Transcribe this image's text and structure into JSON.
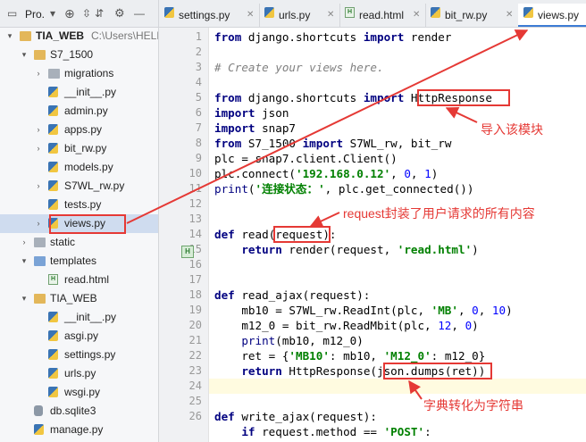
{
  "project_panel": {
    "title": "Pro.",
    "tree": [
      {
        "label": "TIA_WEB",
        "path": "C:\\Users\\HELE",
        "type": "folder-root",
        "expanded": true
      },
      {
        "label": "S7_1500",
        "type": "folder",
        "expanded": true
      },
      {
        "label": "migrations",
        "type": "folder",
        "expanded": false
      },
      {
        "label": "__init__.py",
        "type": "py"
      },
      {
        "label": "admin.py",
        "type": "py"
      },
      {
        "label": "apps.py",
        "type": "py",
        "expanded": false
      },
      {
        "label": "bit_rw.py",
        "type": "py",
        "expanded": false
      },
      {
        "label": "models.py",
        "type": "py"
      },
      {
        "label": "S7WL_rw.py",
        "type": "py",
        "expanded": false
      },
      {
        "label": "tests.py",
        "type": "py"
      },
      {
        "label": "views.py",
        "type": "py",
        "expanded": false,
        "selected": true
      },
      {
        "label": "static",
        "type": "folder",
        "expanded": false
      },
      {
        "label": "templates",
        "type": "folder",
        "expanded": true
      },
      {
        "label": "read.html",
        "type": "html"
      },
      {
        "label": "TIA_WEB",
        "type": "folder",
        "expanded": true
      },
      {
        "label": "__init__.py",
        "type": "py"
      },
      {
        "label": "asgi.py",
        "type": "py"
      },
      {
        "label": "settings.py",
        "type": "py"
      },
      {
        "label": "urls.py",
        "type": "py"
      },
      {
        "label": "wsgi.py",
        "type": "py"
      },
      {
        "label": "db.sqlite3",
        "type": "db"
      },
      {
        "label": "manage.py",
        "type": "py"
      }
    ]
  },
  "tabs": [
    {
      "label": "settings.py",
      "icon": "python-file-icon"
    },
    {
      "label": "urls.py",
      "icon": "python-file-icon"
    },
    {
      "label": "read.html",
      "icon": "html-file-icon"
    },
    {
      "label": "bit_rw.py",
      "icon": "python-file-icon"
    },
    {
      "label": "views.py",
      "icon": "python-file-icon",
      "active": true
    }
  ],
  "line_numbers": [
    "1",
    "2",
    "3",
    "4",
    "5",
    "6",
    "7",
    "8",
    "9",
    "10",
    "11",
    "12",
    "13",
    "14",
    "15",
    "16",
    "17",
    "18",
    "19",
    "20",
    "21",
    "22",
    "23",
    "24",
    "25",
    "26"
  ],
  "code_lines": [
    "from django.shortcuts import render",
    "",
    "# Create your views here.",
    "",
    "from django.shortcuts import HttpResponse",
    "import json",
    "import snap7",
    "from S7_1500 import S7WL_rw, bit_rw",
    "plc = snap7.client.Client()",
    "plc.connect('192.168.0.12', 0, 1)",
    "print('连接状态：', plc.get_connected())",
    "",
    "",
    "def read(request):",
    "    return render(request, 'read.html')",
    "",
    "",
    "def read_ajax(request):",
    "    mb10 = S7WL_rw.ReadInt(plc, 'MB', 0, 10)",
    "    m12_0 = bit_rw.ReadMbit(plc, 12, 0)",
    "    print(mb10, m12_0)",
    "    ret = {'MB10': mb10, 'M12_0': m12_0}",
    "    return HttpResponse(json.dumps(ret))",
    "",
    "",
    "def write_ajax(request):",
    "    if request.method == 'POST':"
  ],
  "annotations": {
    "import_module": "导入该模块",
    "request_note": "request封装了用户请求的所有内容",
    "dict_to_str": "字典转化为字符串"
  },
  "colors": {
    "annotation_red": "#e53935",
    "keyword": "#000080",
    "string": "#008000",
    "number": "#0000ff",
    "comment": "#808080",
    "selection": "#cfdcef"
  }
}
